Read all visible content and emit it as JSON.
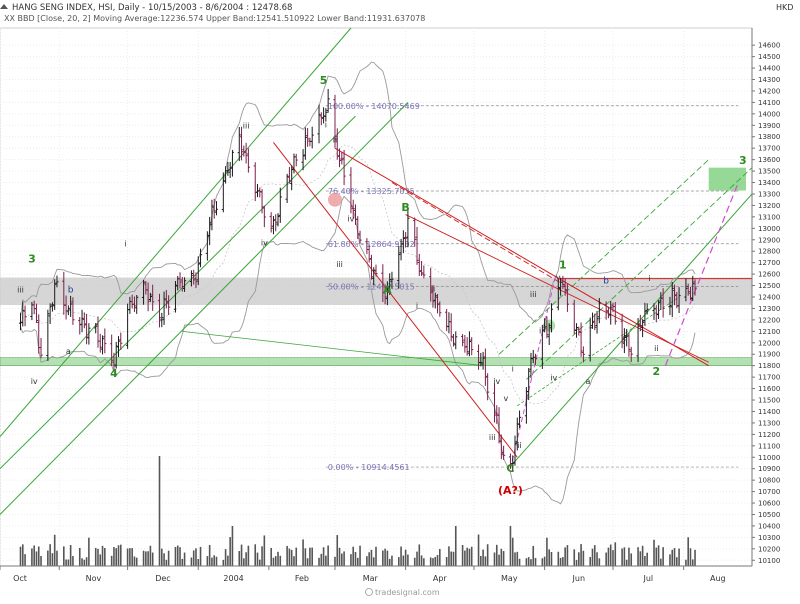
{
  "header": {
    "title": "HANG SENG INDEX, HSI, Daily - 10/15/2003 - 8/6/2004 : 12478.68",
    "indicator": "XX BBD [Close, 20, 2] Moving Average:12236.574 Upper Band:12541.510922 Lower Band:11931.637078",
    "currency": "HKD"
  },
  "footer": {
    "watermark": "tradesignal.com"
  },
  "colors": {
    "up_bar": "#1a1a1a",
    "down_bar": "#7a1f4a",
    "band": "#b5b5b5",
    "green_line": "#3aa53a",
    "red_line": "#d11f1f",
    "magenta_line": "#d24ad2",
    "fib_line": "#8c8c8c",
    "zone_gray": "#c8c8c8",
    "zone_green": "#a6dca6",
    "target_green": "#7ccf7c"
  },
  "chart_data": {
    "type": "ohlc",
    "title": "HANG SENG INDEX, HSI, Daily - 10/15/2003 - 8/6/2004 : 12478.68",
    "xlabel": "",
    "ylabel": "",
    "ylim": [
      10050,
      14750
    ],
    "x_ticks": [
      "Oct",
      "Nov",
      "Dec",
      "2004",
      "Feb",
      "Mar",
      "Apr",
      "May",
      "Jun",
      "Jul",
      "Aug"
    ],
    "y_ticks": [
      14600,
      14500,
      14400,
      14300,
      14200,
      14100,
      14000,
      13900,
      13800,
      13700,
      13600,
      13500,
      13400,
      13300,
      13200,
      13100,
      13000,
      12900,
      12800,
      12700,
      12600,
      12500,
      12400,
      12300,
      12200,
      12100,
      12000,
      11900,
      11800,
      11700,
      11600,
      11500,
      11400,
      11300,
      11200,
      11100,
      11000,
      10900,
      10800,
      10700,
      10600,
      10500,
      10400,
      10300,
      10200,
      10100
    ],
    "grid": true,
    "last_close": 12478.68,
    "price_path": [
      {
        "date": "2003-10-15",
        "close": 12180
      },
      {
        "date": "2003-10-20",
        "close": 12400
      },
      {
        "date": "2003-10-24",
        "close": 11900
      },
      {
        "date": "2003-10-30",
        "close": 12500
      },
      {
        "date": "2003-11-05",
        "close": 12300
      },
      {
        "date": "2003-11-12",
        "close": 12150
      },
      {
        "date": "2003-11-19",
        "close": 12020
      },
      {
        "date": "2003-11-25",
        "close": 11850
      },
      {
        "date": "2003-12-01",
        "close": 12280
      },
      {
        "date": "2003-12-08",
        "close": 12500
      },
      {
        "date": "2003-12-15",
        "close": 12230
      },
      {
        "date": "2003-12-22",
        "close": 12500
      },
      {
        "date": "2003-12-31",
        "close": 12600
      },
      {
        "date": "2004-01-06",
        "close": 13050
      },
      {
        "date": "2004-01-12",
        "close": 13400
      },
      {
        "date": "2004-01-19",
        "close": 13800
      },
      {
        "date": "2004-01-26",
        "close": 13350
      },
      {
        "date": "2004-02-02",
        "close": 12950
      },
      {
        "date": "2004-02-09",
        "close": 13450
      },
      {
        "date": "2004-02-16",
        "close": 13700
      },
      {
        "date": "2004-02-23",
        "close": 13950
      },
      {
        "date": "2004-02-27",
        "close": 14050
      },
      {
        "date": "2004-03-03",
        "close": 13600
      },
      {
        "date": "2004-03-08",
        "close": 13250
      },
      {
        "date": "2004-03-12",
        "close": 12900
      },
      {
        "date": "2004-03-18",
        "close": 12600
      },
      {
        "date": "2004-03-24",
        "close": 12450
      },
      {
        "date": "2004-03-31",
        "close": 12900
      },
      {
        "date": "2004-04-02",
        "close": 13100
      },
      {
        "date": "2004-04-08",
        "close": 12600
      },
      {
        "date": "2004-04-15",
        "close": 12350
      },
      {
        "date": "2004-04-22",
        "close": 12050
      },
      {
        "date": "2004-04-29",
        "close": 11950
      },
      {
        "date": "2004-05-05",
        "close": 11800
      },
      {
        "date": "2004-05-11",
        "close": 11300
      },
      {
        "date": "2004-05-14",
        "close": 11000
      },
      {
        "date": "2004-05-17",
        "close": 10920
      },
      {
        "date": "2004-05-21",
        "close": 11350
      },
      {
        "date": "2004-05-27",
        "close": 11900
      },
      {
        "date": "2004-06-03",
        "close": 12150
      },
      {
        "date": "2004-06-08",
        "close": 12550
      },
      {
        "date": "2004-06-14",
        "close": 12150
      },
      {
        "date": "2004-06-18",
        "close": 11900
      },
      {
        "date": "2004-06-24",
        "close": 12250
      },
      {
        "date": "2004-06-30",
        "close": 12300
      },
      {
        "date": "2004-07-05",
        "close": 12050
      },
      {
        "date": "2004-07-09",
        "close": 11950
      },
      {
        "date": "2004-07-15",
        "close": 12250
      },
      {
        "date": "2004-07-22",
        "close": 12350
      },
      {
        "date": "2004-07-28",
        "close": 12400
      },
      {
        "date": "2004-08-06",
        "close": 12478.68
      }
    ],
    "fibonacci": [
      {
        "label": "100.00% - 14070.5469",
        "value": 14070.5469
      },
      {
        "label": "76.40% - 13325.7035",
        "value": 13325.7035
      },
      {
        "label": "61.80% - 12864.9202",
        "value": 12864.9202
      },
      {
        "label": "50.00% - 12492.5015",
        "value": 12492.5015
      },
      {
        "label": "0.00% - 10914.4561",
        "value": 10914.4561
      }
    ],
    "zones": [
      {
        "name": "resistance",
        "low": 12330,
        "high": 12570
      },
      {
        "name": "support",
        "low": 11800,
        "high": 11870
      },
      {
        "name": "target",
        "low": 13330,
        "high": 13530
      }
    ],
    "wave_labels": [
      {
        "text": "3",
        "style": "primary",
        "date": "2003-10-20",
        "value": 12700
      },
      {
        "text": "4",
        "style": "primary",
        "date": "2003-11-25",
        "value": 11700
      },
      {
        "text": "5",
        "style": "primary",
        "date": "2004-02-25",
        "value": 14260
      },
      {
        "text": "A",
        "style": "primary",
        "date": "2004-03-24",
        "value": 12430
      },
      {
        "text": "B",
        "style": "primary",
        "date": "2004-04-01",
        "value": 13150
      },
      {
        "text": "C",
        "style": "primary",
        "date": "2004-05-17",
        "value": 10870
      },
      {
        "text": "1",
        "style": "primary",
        "date": "2004-06-09",
        "value": 12650
      },
      {
        "text": "2",
        "style": "primary",
        "date": "2004-07-20",
        "value": 11720
      },
      {
        "text": "3",
        "style": "primary",
        "date": "2004-08-27",
        "value": 13560
      },
      {
        "text": "(A?)",
        "style": "alert",
        "date": "2004-05-17",
        "value": 10680
      },
      {
        "text": "iii",
        "style": "minor",
        "date": "2003-10-15",
        "value": 12440
      },
      {
        "text": "iv",
        "style": "minor",
        "date": "2003-10-21",
        "value": 11640
      },
      {
        "text": "a",
        "style": "minor",
        "date": "2003-11-05",
        "value": 11900
      },
      {
        "text": "b",
        "style": "wave-b",
        "date": "2003-11-06",
        "value": 12440
      },
      {
        "text": "i",
        "style": "minor",
        "date": "2003-11-30",
        "value": 12840
      },
      {
        "text": "iii",
        "style": "minor",
        "date": "2004-01-22",
        "value": 13870
      },
      {
        "text": "iv",
        "style": "minor",
        "date": "2004-01-30",
        "value": 12850
      },
      {
        "text": "i",
        "style": "minor",
        "date": "2004-02-26",
        "value": 13880
      },
      {
        "text": "ii",
        "style": "minor",
        "date": "2004-03-01",
        "value": 13750
      },
      {
        "text": "iii",
        "style": "minor",
        "date": "2004-03-03",
        "value": 12660
      },
      {
        "text": "iv",
        "style": "minor",
        "date": "2004-03-08",
        "value": 13060
      },
      {
        "text": "i",
        "style": "minor",
        "date": "2004-04-06",
        "value": 12300
      },
      {
        "text": "ii",
        "style": "minor",
        "date": "2004-04-13",
        "value": 12450
      },
      {
        "text": "iii",
        "style": "minor",
        "date": "2004-05-09",
        "value": 11150
      },
      {
        "text": "iv",
        "style": "minor",
        "date": "2004-05-11",
        "value": 11640
      },
      {
        "text": "v",
        "style": "minor",
        "date": "2004-05-15",
        "value": 11490
      },
      {
        "text": "i",
        "style": "minor",
        "date": "2004-05-18",
        "value": 11750
      },
      {
        "text": "ii",
        "style": "minor",
        "date": "2004-05-21",
        "value": 11080
      },
      {
        "text": "iii",
        "style": "minor",
        "date": "2004-05-27",
        "value": 12400
      },
      {
        "text": "i",
        "style": "minor",
        "date": "2004-05-30",
        "value": 12080
      },
      {
        "text": "iv",
        "style": "minor",
        "date": "2004-06-05",
        "value": 11670
      },
      {
        "text": "v",
        "style": "minor",
        "date": "2004-06-07",
        "value": 12550
      },
      {
        "text": "a",
        "style": "minor",
        "date": "2004-06-20",
        "value": 11640
      },
      {
        "text": "b",
        "style": "wave-b",
        "date": "2004-06-28",
        "value": 12520
      },
      {
        "text": "c",
        "style": "minor",
        "date": "2004-07-06",
        "value": 12020
      },
      {
        "text": "i",
        "style": "minor",
        "date": "2004-07-17",
        "value": 12540
      },
      {
        "text": "ii",
        "style": "minor",
        "date": "2004-07-20",
        "value": 11930
      }
    ]
  }
}
